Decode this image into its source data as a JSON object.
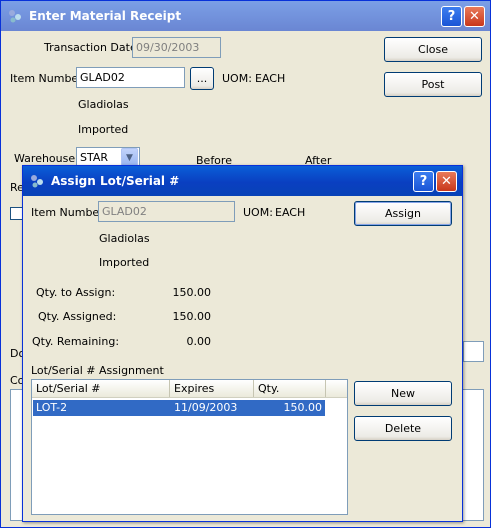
{
  "main_window": {
    "title": "Enter Material Receipt",
    "help_btn": "?",
    "close_btn": "✕",
    "transaction_date_label": "Transaction Date:",
    "transaction_date_value": "09/30/2003",
    "item_number_label": "Item Number:",
    "item_number_value": "GLAD02",
    "browse_btn": "...",
    "uom_label": "UOM:",
    "uom_value": "EACH",
    "item_desc1": "Gladiolas",
    "item_desc2": "Imported",
    "warehouse_label": "Warehouse:",
    "warehouse_value": "STAR",
    "before_label": "Before",
    "after_label": "After",
    "re_label_fragment": "Re",
    "do_label_fragment": "Do",
    "co_label_fragment": "Co",
    "close_button": "Close",
    "post_button": "Post"
  },
  "dialog": {
    "title": "Assign Lot/Serial #",
    "help_btn": "?",
    "close_btn": "✕",
    "item_number_label": "Item Number:",
    "item_number_value": "GLAD02",
    "uom_label": "UOM:",
    "uom_value": "EACH",
    "item_desc1": "Gladiolas",
    "item_desc2": "Imported",
    "qty_to_assign_label": "Qty. to Assign:",
    "qty_to_assign_value": "150.00",
    "qty_assigned_label": "Qty. Assigned:",
    "qty_assigned_value": "150.00",
    "qty_remaining_label": "Qty. Remaining:",
    "qty_remaining_value": "0.00",
    "assignment_label": "Lot/Serial # Assignment",
    "assign_button": "Assign",
    "new_button": "New",
    "delete_button": "Delete",
    "grid": {
      "columns": [
        "Lot/Serial #",
        "Expires",
        "Qty."
      ],
      "rows": [
        {
          "lot": "LOT-2",
          "expires": "11/09/2003",
          "qty": "150.00"
        }
      ]
    }
  }
}
